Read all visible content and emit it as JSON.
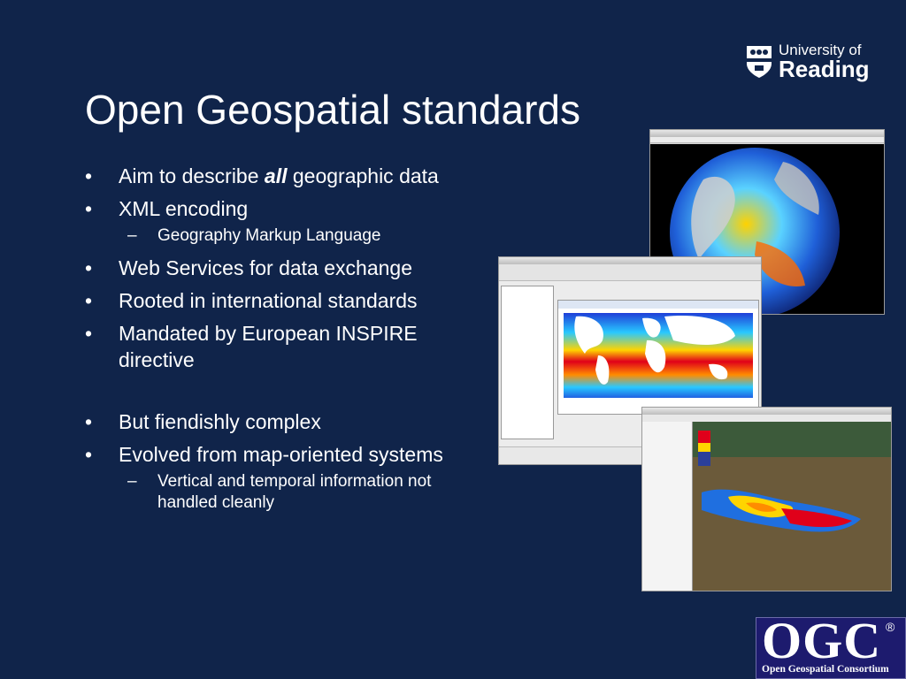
{
  "slide": {
    "title": "Open Geospatial standards",
    "bullets": [
      {
        "text_before": "Aim to describe ",
        "emph": "all",
        "text_after": " geographic data"
      },
      {
        "text": "XML encoding"
      },
      {
        "text": "Web Services for data exchange"
      },
      {
        "text": "Rooted in international standards"
      },
      {
        "text": "Mandated by European INSPIRE directive"
      },
      {
        "text": "But fiendishly complex"
      },
      {
        "text": "Evolved from map-oriented systems"
      }
    ],
    "sub_bullets": [
      {
        "text": "Geography Markup Language"
      },
      {
        "text": "Vertical and temporal information not handled cleanly"
      }
    ],
    "bullet_glyph": "•",
    "dash_glyph": "–"
  },
  "logos": {
    "university": {
      "line1": "University of",
      "line2": "Reading"
    },
    "ogc": {
      "big": "OGC",
      "reg": "®",
      "small": "Open Geospatial Consortium"
    }
  },
  "colors": {
    "background": "#10244a",
    "text": "#ffffff",
    "ogc_bg": "#1d1b6e"
  }
}
